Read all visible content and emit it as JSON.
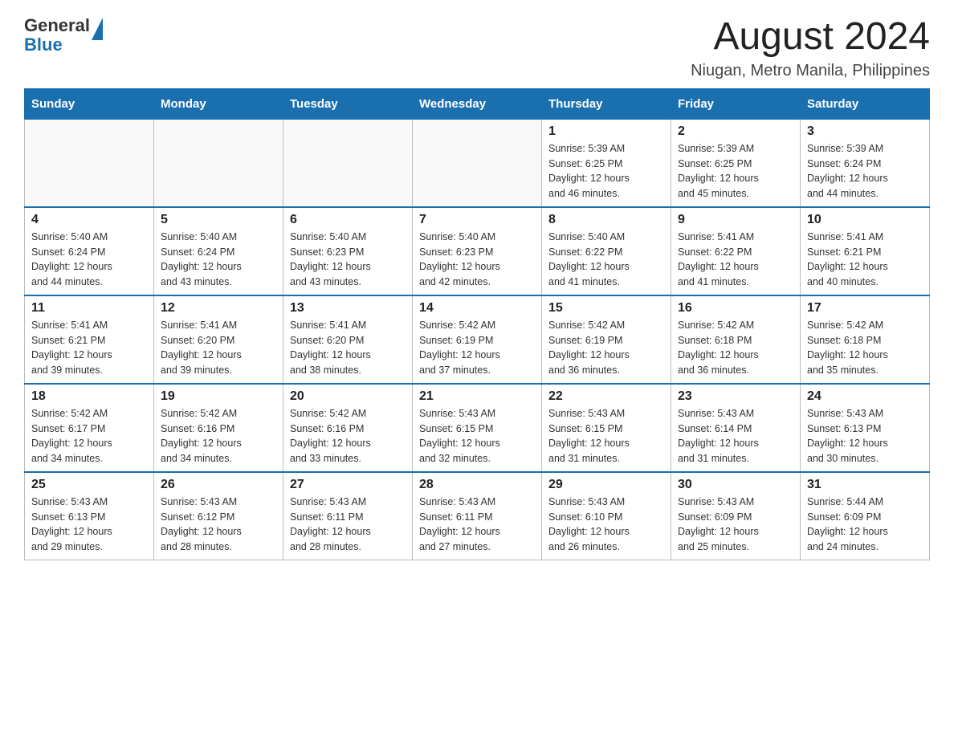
{
  "header": {
    "logo_general": "General",
    "logo_blue": "Blue",
    "month_year": "August 2024",
    "location": "Niugan, Metro Manila, Philippines"
  },
  "days_of_week": [
    "Sunday",
    "Monday",
    "Tuesday",
    "Wednesday",
    "Thursday",
    "Friday",
    "Saturday"
  ],
  "weeks": [
    [
      {
        "day": "",
        "info": ""
      },
      {
        "day": "",
        "info": ""
      },
      {
        "day": "",
        "info": ""
      },
      {
        "day": "",
        "info": ""
      },
      {
        "day": "1",
        "info": "Sunrise: 5:39 AM\nSunset: 6:25 PM\nDaylight: 12 hours\nand 46 minutes."
      },
      {
        "day": "2",
        "info": "Sunrise: 5:39 AM\nSunset: 6:25 PM\nDaylight: 12 hours\nand 45 minutes."
      },
      {
        "day": "3",
        "info": "Sunrise: 5:39 AM\nSunset: 6:24 PM\nDaylight: 12 hours\nand 44 minutes."
      }
    ],
    [
      {
        "day": "4",
        "info": "Sunrise: 5:40 AM\nSunset: 6:24 PM\nDaylight: 12 hours\nand 44 minutes."
      },
      {
        "day": "5",
        "info": "Sunrise: 5:40 AM\nSunset: 6:24 PM\nDaylight: 12 hours\nand 43 minutes."
      },
      {
        "day": "6",
        "info": "Sunrise: 5:40 AM\nSunset: 6:23 PM\nDaylight: 12 hours\nand 43 minutes."
      },
      {
        "day": "7",
        "info": "Sunrise: 5:40 AM\nSunset: 6:23 PM\nDaylight: 12 hours\nand 42 minutes."
      },
      {
        "day": "8",
        "info": "Sunrise: 5:40 AM\nSunset: 6:22 PM\nDaylight: 12 hours\nand 41 minutes."
      },
      {
        "day": "9",
        "info": "Sunrise: 5:41 AM\nSunset: 6:22 PM\nDaylight: 12 hours\nand 41 minutes."
      },
      {
        "day": "10",
        "info": "Sunrise: 5:41 AM\nSunset: 6:21 PM\nDaylight: 12 hours\nand 40 minutes."
      }
    ],
    [
      {
        "day": "11",
        "info": "Sunrise: 5:41 AM\nSunset: 6:21 PM\nDaylight: 12 hours\nand 39 minutes."
      },
      {
        "day": "12",
        "info": "Sunrise: 5:41 AM\nSunset: 6:20 PM\nDaylight: 12 hours\nand 39 minutes."
      },
      {
        "day": "13",
        "info": "Sunrise: 5:41 AM\nSunset: 6:20 PM\nDaylight: 12 hours\nand 38 minutes."
      },
      {
        "day": "14",
        "info": "Sunrise: 5:42 AM\nSunset: 6:19 PM\nDaylight: 12 hours\nand 37 minutes."
      },
      {
        "day": "15",
        "info": "Sunrise: 5:42 AM\nSunset: 6:19 PM\nDaylight: 12 hours\nand 36 minutes."
      },
      {
        "day": "16",
        "info": "Sunrise: 5:42 AM\nSunset: 6:18 PM\nDaylight: 12 hours\nand 36 minutes."
      },
      {
        "day": "17",
        "info": "Sunrise: 5:42 AM\nSunset: 6:18 PM\nDaylight: 12 hours\nand 35 minutes."
      }
    ],
    [
      {
        "day": "18",
        "info": "Sunrise: 5:42 AM\nSunset: 6:17 PM\nDaylight: 12 hours\nand 34 minutes."
      },
      {
        "day": "19",
        "info": "Sunrise: 5:42 AM\nSunset: 6:16 PM\nDaylight: 12 hours\nand 34 minutes."
      },
      {
        "day": "20",
        "info": "Sunrise: 5:42 AM\nSunset: 6:16 PM\nDaylight: 12 hours\nand 33 minutes."
      },
      {
        "day": "21",
        "info": "Sunrise: 5:43 AM\nSunset: 6:15 PM\nDaylight: 12 hours\nand 32 minutes."
      },
      {
        "day": "22",
        "info": "Sunrise: 5:43 AM\nSunset: 6:15 PM\nDaylight: 12 hours\nand 31 minutes."
      },
      {
        "day": "23",
        "info": "Sunrise: 5:43 AM\nSunset: 6:14 PM\nDaylight: 12 hours\nand 31 minutes."
      },
      {
        "day": "24",
        "info": "Sunrise: 5:43 AM\nSunset: 6:13 PM\nDaylight: 12 hours\nand 30 minutes."
      }
    ],
    [
      {
        "day": "25",
        "info": "Sunrise: 5:43 AM\nSunset: 6:13 PM\nDaylight: 12 hours\nand 29 minutes."
      },
      {
        "day": "26",
        "info": "Sunrise: 5:43 AM\nSunset: 6:12 PM\nDaylight: 12 hours\nand 28 minutes."
      },
      {
        "day": "27",
        "info": "Sunrise: 5:43 AM\nSunset: 6:11 PM\nDaylight: 12 hours\nand 28 minutes."
      },
      {
        "day": "28",
        "info": "Sunrise: 5:43 AM\nSunset: 6:11 PM\nDaylight: 12 hours\nand 27 minutes."
      },
      {
        "day": "29",
        "info": "Sunrise: 5:43 AM\nSunset: 6:10 PM\nDaylight: 12 hours\nand 26 minutes."
      },
      {
        "day": "30",
        "info": "Sunrise: 5:43 AM\nSunset: 6:09 PM\nDaylight: 12 hours\nand 25 minutes."
      },
      {
        "day": "31",
        "info": "Sunrise: 5:44 AM\nSunset: 6:09 PM\nDaylight: 12 hours\nand 24 minutes."
      }
    ]
  ]
}
